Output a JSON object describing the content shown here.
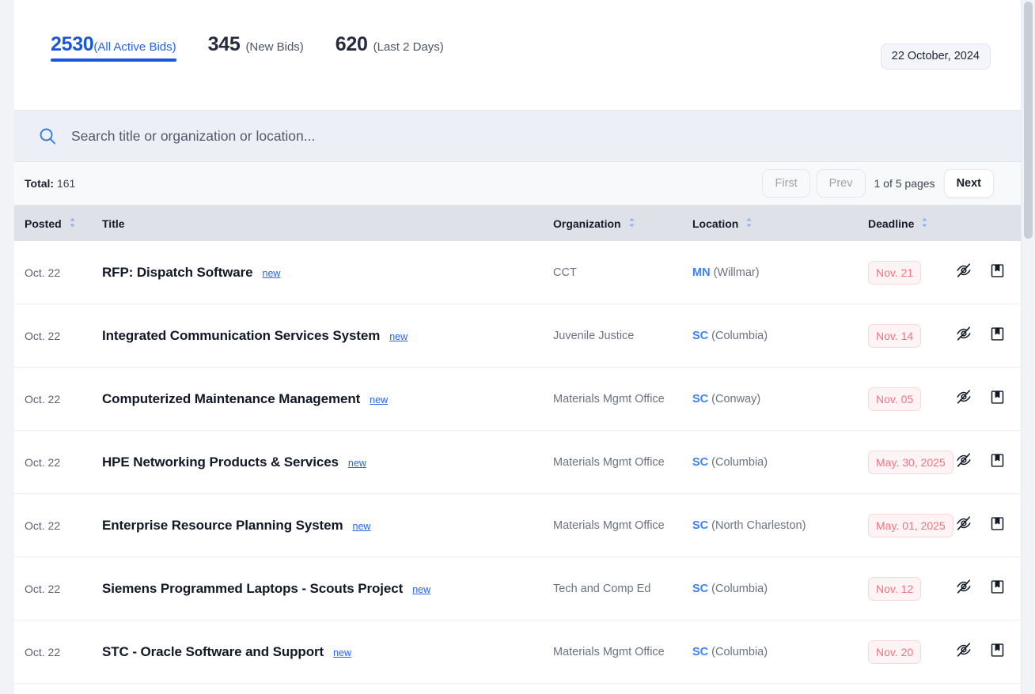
{
  "tabs": [
    {
      "count": "2530",
      "label": "(All Active Bids)",
      "active": true
    },
    {
      "count": "345",
      "label": "(New Bids)",
      "active": false
    },
    {
      "count": "620",
      "label": "(Last 2 Days)",
      "active": false
    }
  ],
  "date_badge": "22 October, 2024",
  "search": {
    "placeholder": "Search title or organization or location...",
    "value": "",
    "icon": "search-icon"
  },
  "pagination": {
    "total_label": "Total:",
    "total_value": "161",
    "first": "First",
    "prev": "Prev",
    "page_info": "1 of 5 pages",
    "next": "Next"
  },
  "columns": {
    "posted": "Posted",
    "title": "Title",
    "organization": "Organization",
    "location": "Location",
    "deadline": "Deadline"
  },
  "colors": {
    "accent_blue": "#1a56db",
    "link_blue": "#2563eb",
    "state_blue": "#3b82f6",
    "deadline_red": "#f4737f",
    "deadline_bg": "#fef4f5",
    "header_bg": "#dee1e8",
    "search_bg": "#eceff5"
  },
  "row_icons": {
    "hide": "eye-off-icon",
    "bookmark": "bookmark-icon"
  },
  "new_badge_label": "new",
  "rows": [
    {
      "posted": "Oct. 22",
      "title": "RFP: Dispatch Software",
      "new": "new",
      "org": "CCT",
      "state": "MN",
      "city": "(Willmar)",
      "deadline": "Nov. 21"
    },
    {
      "posted": "Oct. 22",
      "title": "Integrated Communication Services System",
      "new": "new",
      "org": "Juvenile Justice",
      "state": "SC",
      "city": "(Columbia)",
      "deadline": "Nov. 14"
    },
    {
      "posted": "Oct. 22",
      "title": "Computerized Maintenance Management",
      "new": "new",
      "org": "Materials Mgmt Office",
      "state": "SC",
      "city": "(Conway)",
      "deadline": "Nov. 05"
    },
    {
      "posted": "Oct. 22",
      "title": "HPE Networking Products & Services",
      "new": "new",
      "org": "Materials Mgmt Office",
      "state": "SC",
      "city": "(Columbia)",
      "deadline": "May. 30, 2025"
    },
    {
      "posted": "Oct. 22",
      "title": "Enterprise Resource Planning System",
      "new": "new",
      "org": "Materials Mgmt Office",
      "state": "SC",
      "city": "(North Charleston)",
      "deadline": "May. 01, 2025"
    },
    {
      "posted": "Oct. 22",
      "title": "Siemens Programmed Laptops - Scouts Project",
      "new": "new",
      "org": "Tech and Comp Ed",
      "state": "SC",
      "city": "(Columbia)",
      "deadline": "Nov. 12"
    },
    {
      "posted": "Oct. 22",
      "title": "STC - Oracle Software and Support",
      "new": "new",
      "org": "Materials Mgmt Office",
      "state": "SC",
      "city": "(Columbia)",
      "deadline": "Nov. 20"
    }
  ]
}
